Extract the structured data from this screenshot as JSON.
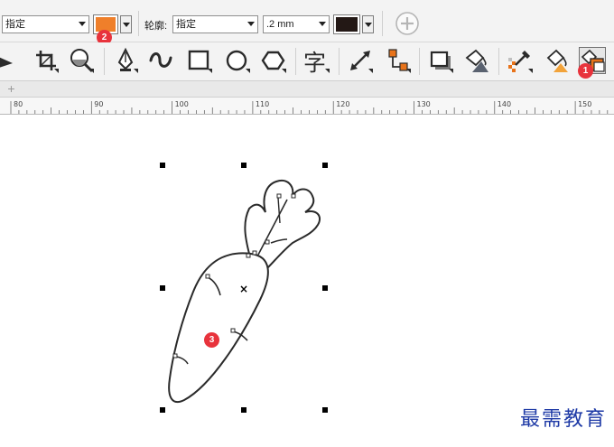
{
  "property_bar": {
    "fill_dropdown": {
      "value": "指定"
    },
    "fill_color": {
      "color": "#ef7f2a"
    },
    "outline_label": "轮廓:",
    "outline_dropdown": {
      "value": "指定"
    },
    "outline_width": {
      "value": ".2 mm"
    },
    "outline_color": {
      "color": "#231815"
    },
    "add_icon": "plus-circle-icon"
  },
  "badges": {
    "fill_color": "2",
    "tool_highlight": "1",
    "drawing": "3"
  },
  "toolbox": {
    "tools": [
      {
        "name": "pick-tool",
        "icon": "arrow-icon"
      },
      {
        "name": "crop-tool",
        "icon": "crop-icon"
      },
      {
        "name": "zoom-tool",
        "icon": "magnifier-icon"
      },
      {
        "name": "pen-tool",
        "icon": "pen-nib-icon"
      },
      {
        "name": "curve-tool",
        "icon": "squiggle-icon"
      },
      {
        "name": "rectangle-tool",
        "icon": "rectangle-icon"
      },
      {
        "name": "ellipse-tool",
        "icon": "ellipse-icon"
      },
      {
        "name": "polygon-tool",
        "icon": "hexagon-icon"
      },
      {
        "name": "text-tool",
        "icon": "text-glyph-icon",
        "glyph": "字"
      },
      {
        "name": "dimension-tool",
        "icon": "diagonal-dimension-icon"
      },
      {
        "name": "connector-tool",
        "icon": "connector-icon"
      },
      {
        "name": "drop-shadow-tool",
        "icon": "drop-shadow-icon"
      },
      {
        "name": "transparency-tool",
        "icon": "transparency-icon"
      },
      {
        "name": "eyedropper-tool",
        "icon": "eyedropper-icon"
      },
      {
        "name": "interactive-fill-tool",
        "icon": "paint-bucket-icon"
      },
      {
        "name": "smart-fill-tool",
        "icon": "smart-fill-icon"
      }
    ],
    "colors": {
      "accent_orange": "#e8731a",
      "icon_dark": "#2b2b2b"
    }
  },
  "ruler": {
    "labels": [
      "80",
      "90",
      "100",
      "110",
      "120",
      "130",
      "140",
      "150"
    ]
  },
  "canvas": {
    "center_marker": "×",
    "watermark": "最需教育"
  }
}
